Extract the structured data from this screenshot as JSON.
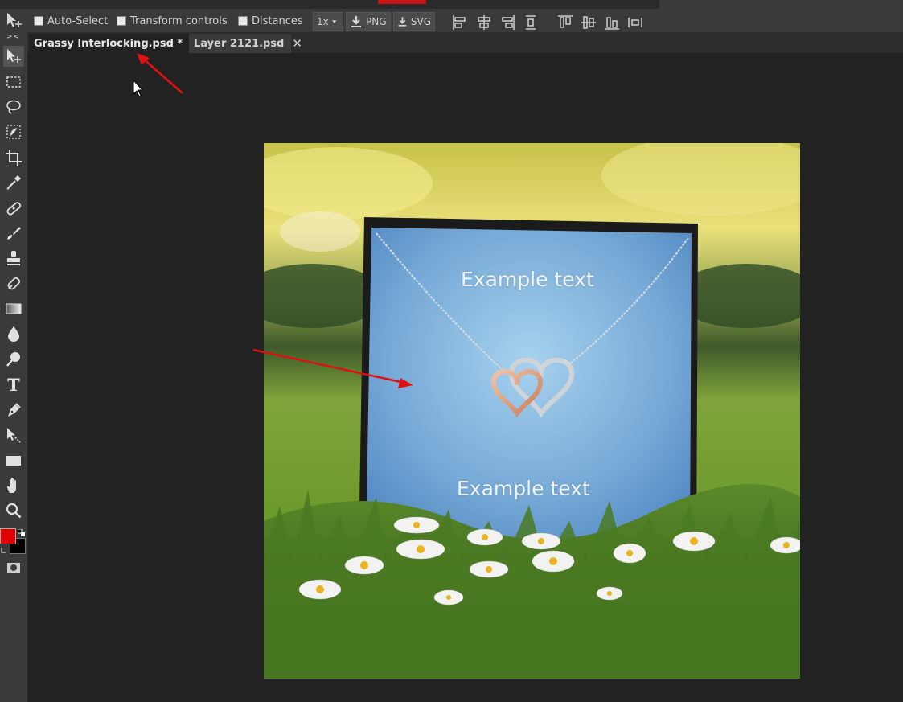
{
  "options_bar": {
    "auto_select_label": "Auto-Select",
    "transform_controls_label": "Transform controls",
    "distances_label": "Distances",
    "zoom_value": "1x",
    "export_png_label": "PNG",
    "export_svg_label": "SVG"
  },
  "toolbar": {
    "collapse_glyph": "> <",
    "text_tool_glyph": "T",
    "foreground_color": "#e00000",
    "background_color": "#000000"
  },
  "tabs": [
    {
      "label": "Grassy Interlocking.psd *",
      "close": "✕",
      "active": true
    },
    {
      "label": "Layer 2121.psd",
      "close": "✕",
      "active": false
    }
  ],
  "document": {
    "text_top": "Example text",
    "text_bottom": "Example text"
  },
  "colors": {
    "annotation_arrow": "#e01010",
    "card_blue": "#7fb0dc",
    "grass_green": "#4f7d2a"
  }
}
